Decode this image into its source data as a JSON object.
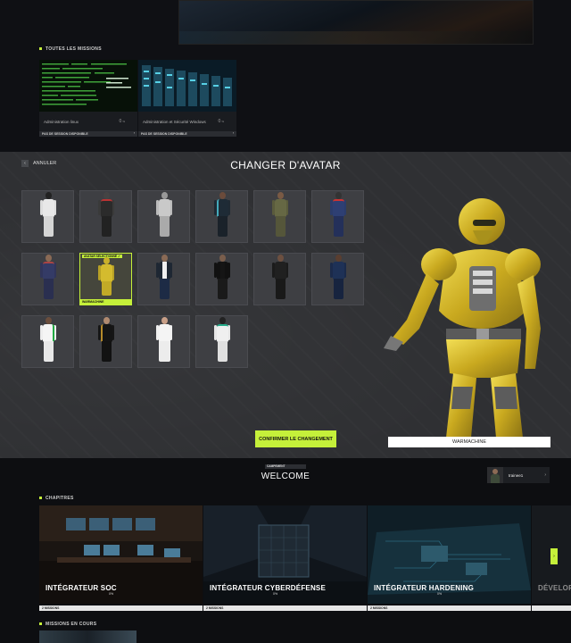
{
  "all_missions": {
    "label": "TOUTES LES MISSIONS",
    "cards": [
      {
        "title": "Administration linux",
        "pct": "0",
        "pct_unit": "%",
        "footer": "PAS DE SESSION DISPONIBLE",
        "arrow": "›"
      },
      {
        "title": "Administration et Sécurité Windows",
        "pct": "0",
        "pct_unit": "%",
        "footer": "PAS DE SESSION DISPONIBLE",
        "arrow": "›"
      }
    ]
  },
  "avatar_modal": {
    "cancel_label": "ANNULER",
    "cancel_icon": "‹",
    "title": "CHANGER D'AVATAR",
    "selected_tag": "AVATAR SÉLECTIONNÉ ✓",
    "selected_name": "WARMACHINE",
    "confirm_label": "CONFIRMER LE CHANGEMENT",
    "preview_name": "WARMACHINE",
    "accent_color": "#c5f03a"
  },
  "campaign": {
    "label": "CAMPEMENT",
    "title": "WELCOME",
    "user_name": "trainee1",
    "user_chevron": "›"
  },
  "chapters": {
    "label": "CHAPITRES",
    "items": [
      {
        "title": "INTÉGRATEUR SOC",
        "pct": "0%",
        "footer": "2 MISSIONS"
      },
      {
        "title": "INTÉGRATEUR CYBERDÉFENSE",
        "pct": "0%",
        "footer": "2 MISSIONS"
      },
      {
        "title": "INTÉGRATEUR HARDENING",
        "pct": "0%",
        "footer": "2 MISSIONS"
      },
      {
        "title": "DÉVELOP",
        "pct": "",
        "footer": ""
      }
    ],
    "next_icon": "›"
  },
  "current_missions": {
    "label": "MISSIONS EN COURS"
  }
}
